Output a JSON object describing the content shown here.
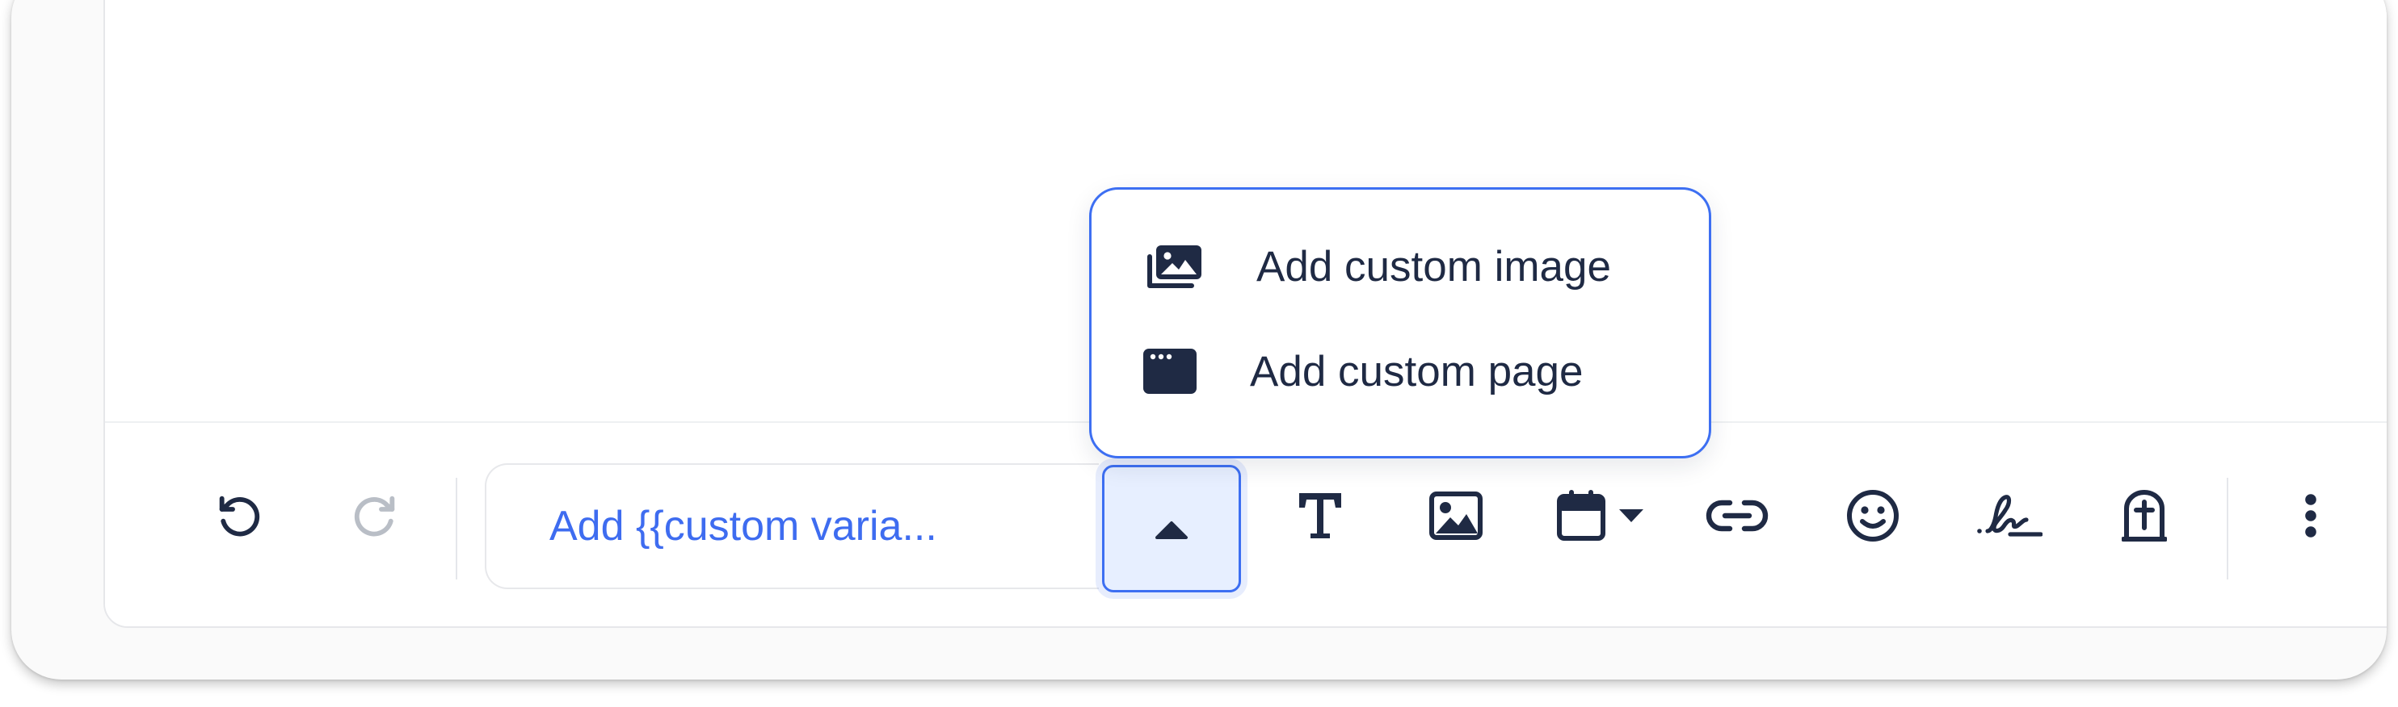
{
  "colors": {
    "accent": "#3d6ff2",
    "accent_bg": "#e7efff",
    "icon": "#1f2a44",
    "icon_disabled": "#b9bec6",
    "variable_text": "#3e6cf0"
  },
  "toolbar": {
    "undo_icon": "undo-icon",
    "redo_icon": "redo-icon",
    "custom_variable_text": "Add {{custom varia...",
    "dropdown_icon": "caret-up-icon",
    "text_icon": "text-format-icon",
    "image_icon": "image-icon",
    "date_icon": "calendar-icon",
    "link_icon": "link-icon",
    "emoji_icon": "emoji-icon",
    "signature_icon": "signature-icon",
    "tombstone_icon": "tombstone-icon",
    "more_icon": "more-vertical-icon"
  },
  "popup_menu": {
    "items": [
      {
        "label": "Add custom image",
        "icon": "images-stack-icon"
      },
      {
        "label": "Add custom page",
        "icon": "browser-window-icon"
      }
    ]
  }
}
